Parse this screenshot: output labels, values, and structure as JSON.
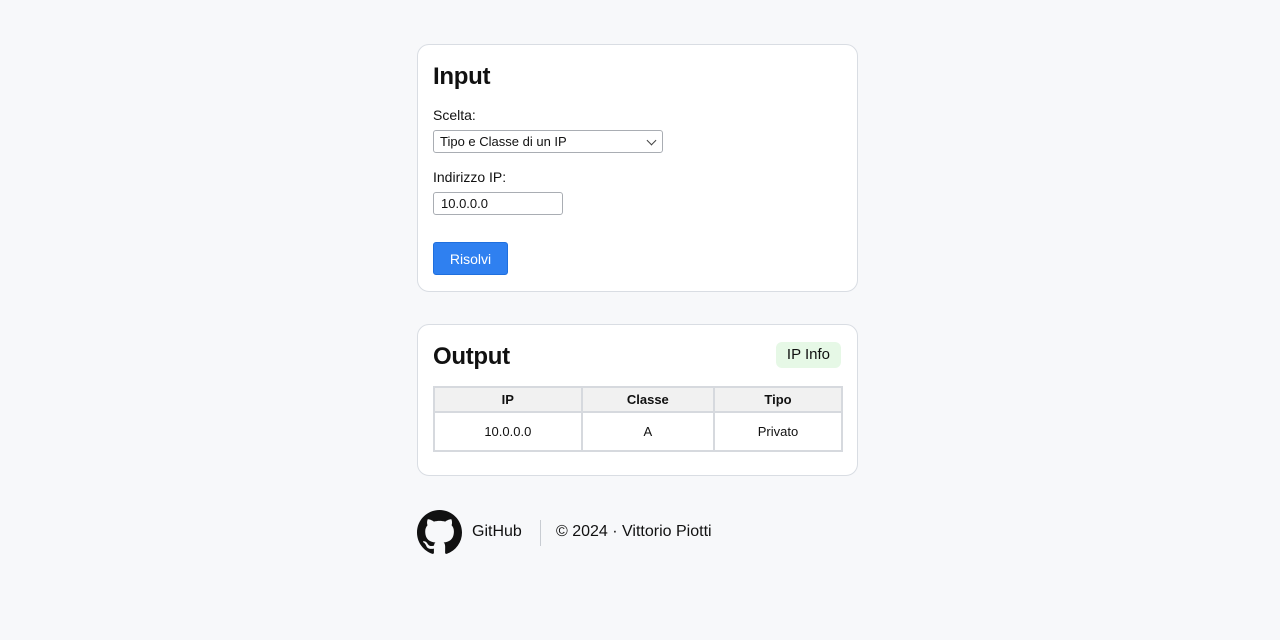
{
  "input_card": {
    "title": "Input",
    "scelta_label": "Scelta:",
    "scelta_selected": "Tipo e Classe di un IP",
    "ip_label": "Indirizzo IP:",
    "ip_value": "10.0.0.0",
    "submit_label": "Risolvi"
  },
  "output_card": {
    "title": "Output",
    "badge": "IP Info",
    "table": {
      "headers": [
        "IP",
        "Classe",
        "Tipo"
      ],
      "rows": [
        [
          "10.0.0.0",
          "A",
          "Privato"
        ]
      ]
    }
  },
  "footer": {
    "github_label": "GitHub",
    "copyright": "© 2024 · Vittorio Piotti"
  },
  "colors": {
    "page_bg": "#f7f8fa",
    "button_bg": "#2f80f0",
    "badge_bg": "#e6f8e6"
  },
  "icons": {
    "github": "github-icon",
    "select_arrow": "chevron-down-icon"
  }
}
